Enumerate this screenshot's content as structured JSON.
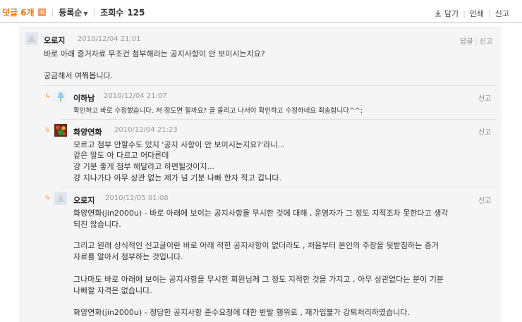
{
  "header": {
    "comment_label": "덧글",
    "comment_count": "6개",
    "new_badge": "N",
    "sort_label": "등록순",
    "views_label": "조회수",
    "views_count": "125",
    "save_label": "담기",
    "print_label": "인쇄",
    "report_label": "신고"
  },
  "comments": [
    {
      "author": "오로지",
      "date": "2010/12/04 21:01",
      "reply_label": "답글",
      "report_label": "신고",
      "lines": [
        "바로 아래 증거자료 무조건 첨부해라는 공지사항이 안 보이시는지요?",
        "",
        "궁금해서 여쭤봅니다."
      ]
    },
    {
      "author": "이하남",
      "date": "2010/12/04 21:07",
      "report_label": "신고",
      "lines": [
        "확인하고 바로 수정했습니다. 저 정도면 될까요? 글 올리고 나서야 확인하고 수정하네요 죄송합니다^^;"
      ]
    },
    {
      "author": "화양연화",
      "date": "2010/12/04 21:23",
      "report_label": "신고",
      "lines": [
        "모르고 첨부 안할수도 있지 '공지 사항이 안 보이시는지요?'라니...",
        "같은 말도 아 다르고 어다른데",
        "걍 기분 좋게 첨부 해달라고 하면될것이지...",
        "걍 지나가다 아무 상관 없는 제가 넘 기분 나빠 한자 적고 갑니다."
      ]
    },
    {
      "author": "오로지",
      "date": "2010/12/05 01:08",
      "report_label": "신고",
      "lines": [
        "화양연화(jin2000u) - 바로 아래에 보이는 공지사항을 무시한 것에 대해 , 운영자가 그 정도 지적조차 못한다고 생각",
        "되진 않습니다.",
        "",
        "그리고 원래 상식적인 신고글이란 바로 아래 적힌 공지사항이 없더라도 , 처음부터 본인의 주장을 뒷받침하는 증거",
        "자료를 알아서 첨부하는 것입니다.",
        "",
        "그나마도 바로 아래에 보이는 공지사항을 무시한 회원님께 그 정도 지적한 것을 가지고 , 아무 상관없다는 분이 기분",
        "나빠할 자격은 없습니다.",
        "",
        "화양연화(jin2000u) - 정당한 공지사항 준수요청에 대한 반발 행위로 , 재가입불가 강퇴처리하였습니다."
      ]
    }
  ],
  "colors": {
    "accent": "#f07a1a",
    "box_bg": "#f5f5f5"
  }
}
